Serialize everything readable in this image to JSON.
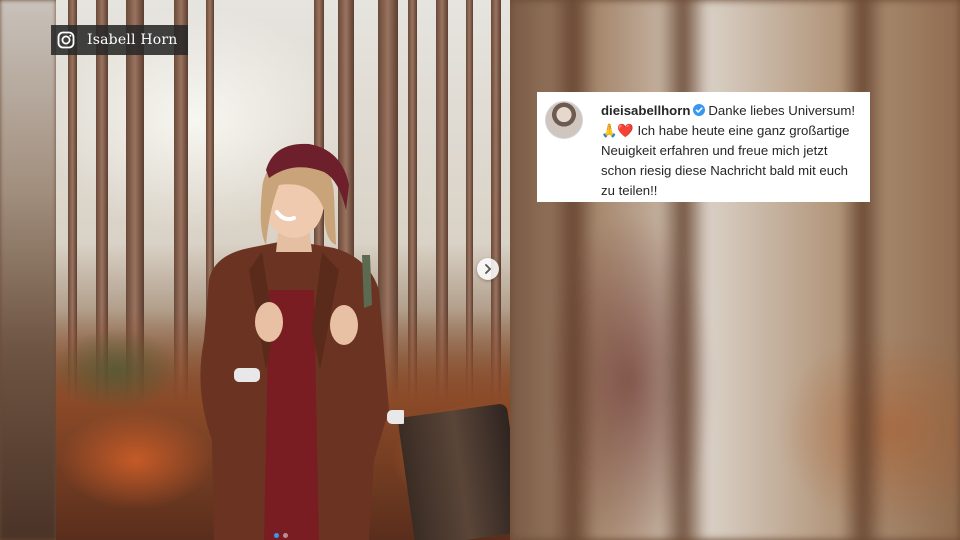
{
  "credit": {
    "icon": "instagram-icon",
    "name": "Isabell Horn"
  },
  "post": {
    "carousel": {
      "next_icon": "chevron-right-icon",
      "dots": 2,
      "active_dot": 0
    }
  },
  "caption": {
    "username": "dieisabellhorn",
    "verified_icon": "verified-badge-icon",
    "text_before_emoji": "Danke liebes Universum!",
    "emoji_1": "🙏",
    "emoji_2": "❤️",
    "text_after_emoji": "Ich habe heute eine ganz großartige Neuigkeit erfahren und freue mich jetzt schon riesig diese Nachricht bald mit euch zu teilen!!"
  },
  "colors": {
    "caption_bg": "#ffffff",
    "verified_blue": "#3897f0",
    "credit_bg": "#282828"
  }
}
